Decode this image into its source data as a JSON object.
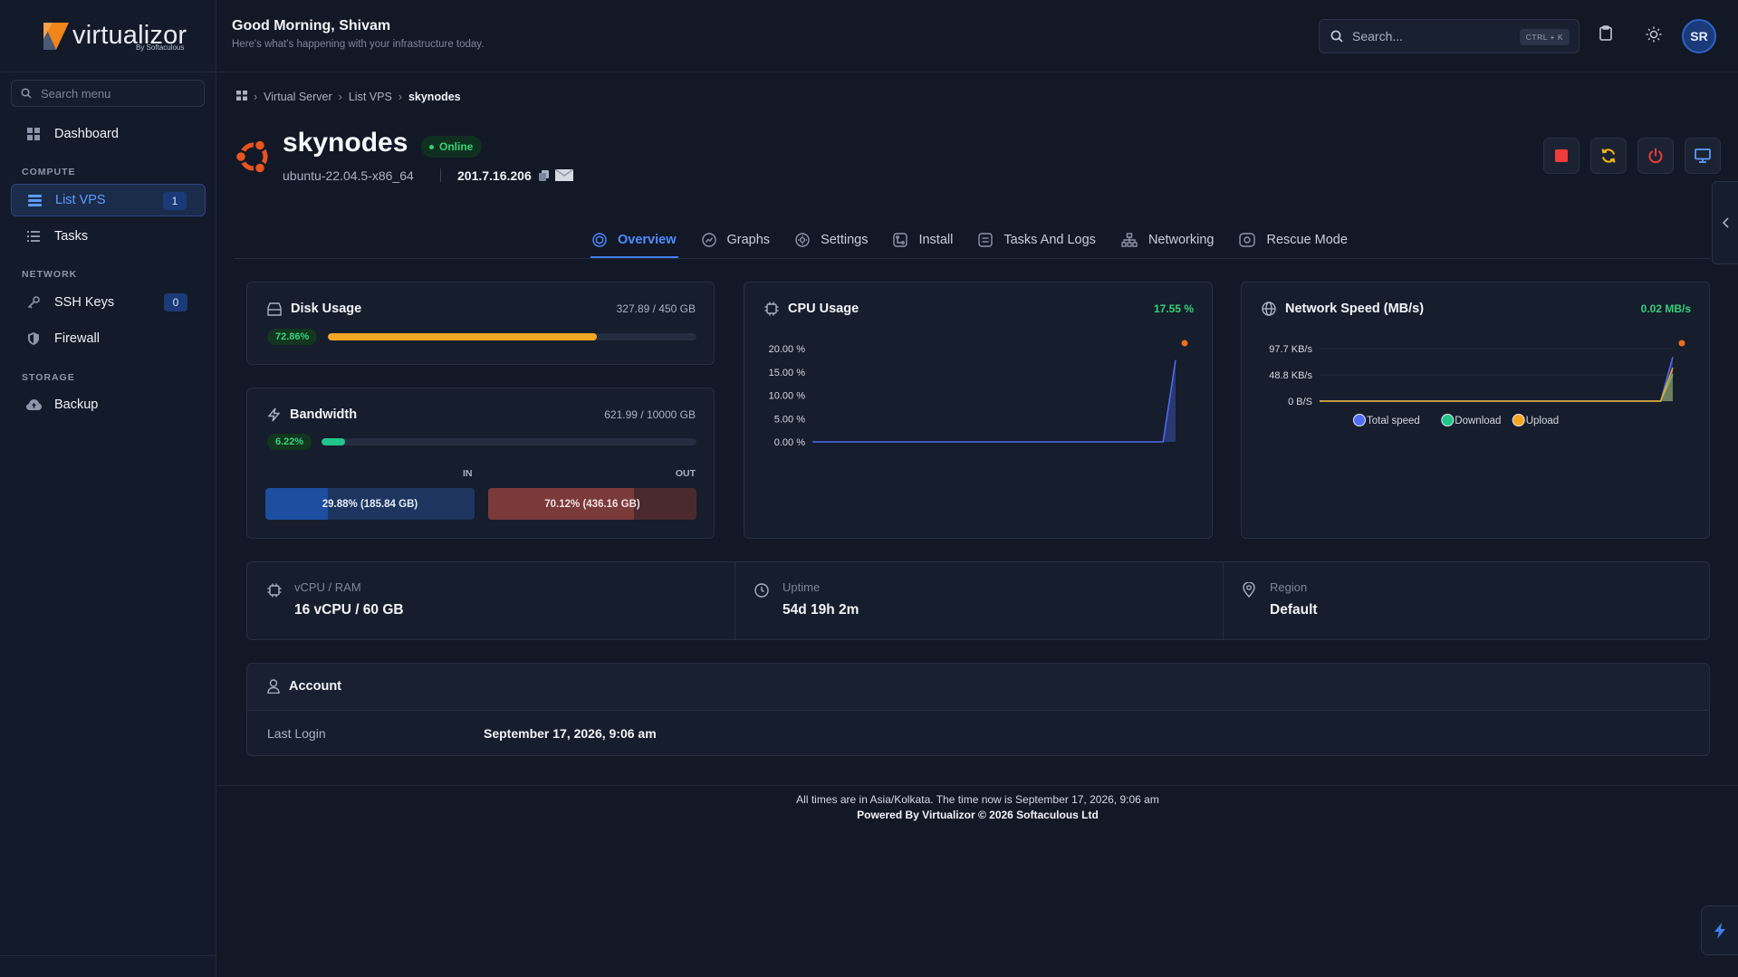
{
  "sidebar": {
    "logo_text": "virtualizor",
    "logo_sub": "By Softaculous",
    "search_placeholder": "Search menu",
    "dashboard": "Dashboard",
    "sections": {
      "compute": "COMPUTE",
      "network": "NETWORK",
      "storage": "STORAGE"
    },
    "list_vps": {
      "label": "List VPS",
      "count": "1"
    },
    "tasks": "Tasks",
    "ssh_keys": {
      "label": "SSH Keys",
      "count": "0"
    },
    "firewall": "Firewall",
    "backup": "Backup"
  },
  "header": {
    "greeting": "Good Morning, Shivam",
    "subtitle": "Here's what's happening with your infrastructure today.",
    "search_placeholder": "Search...",
    "shortcut": "CTRL + K",
    "avatar_initials": "SR"
  },
  "breadcrumb": {
    "items": [
      "Virtual Server",
      "List VPS"
    ],
    "current": "skynodes"
  },
  "vps": {
    "name": "skynodes",
    "status": "Online",
    "os": "ubuntu-22.04.5-x86_64",
    "ip": "201.7.16.206"
  },
  "tabs": [
    "Overview",
    "Graphs",
    "Settings",
    "Install",
    "Tasks And Logs",
    "Networking",
    "Rescue Mode"
  ],
  "disk": {
    "title": "Disk Usage",
    "usage": "327.89 / 450 GB",
    "percent_label": "72.86%",
    "percent": 72.86
  },
  "bandwidth": {
    "title": "Bandwidth",
    "usage": "621.99 / 10000 GB",
    "percent_label": "6.22%",
    "percent": 6.22,
    "in_label": "IN",
    "out_label": "OUT",
    "in_text": "29.88% (185.84 GB)",
    "out_text": "70.12% (436.16 GB)",
    "in_percent": 29.88,
    "out_percent": 70.12
  },
  "cpu": {
    "title": "CPU Usage",
    "value": "17.55 %"
  },
  "network": {
    "title": "Network Speed (MB/s)",
    "value": "0.02 MB/s"
  },
  "chart_data": [
    {
      "type": "area",
      "title": "CPU Usage",
      "y_ticks": [
        "20.00 %",
        "15.00 %",
        "10.00 %",
        "5.00 %",
        "0.00 %"
      ],
      "ylim": [
        0,
        20
      ],
      "series": [
        {
          "values": [
            0,
            0,
            0,
            0,
            0,
            0,
            0,
            0,
            0,
            0,
            0,
            0,
            0,
            0,
            0,
            0,
            0,
            0,
            0,
            0,
            0,
            0,
            0,
            0,
            0,
            0,
            0,
            0,
            0,
            17.55
          ]
        }
      ]
    },
    {
      "type": "area",
      "title": "Network Speed (MB/s)",
      "y_ticks": [
        "97.7 KB/s",
        "48.8 KB/s",
        "0 B/S"
      ],
      "ylim": [
        0,
        97.7
      ],
      "series": [
        {
          "name": "Total speed",
          "color": "#4f6df5",
          "values": [
            0,
            0,
            0,
            0,
            0,
            0,
            0,
            0,
            0,
            0,
            0,
            0,
            0,
            0,
            0,
            0,
            0,
            0,
            0,
            0,
            0,
            0,
            0,
            0,
            0,
            0,
            0,
            0,
            0,
            82
          ]
        },
        {
          "name": "Download",
          "color": "#22c58b",
          "values": [
            0,
            0,
            0,
            0,
            0,
            0,
            0,
            0,
            0,
            0,
            0,
            0,
            0,
            0,
            0,
            0,
            0,
            0,
            0,
            0,
            0,
            0,
            0,
            0,
            0,
            0,
            0,
            0,
            0,
            50
          ]
        },
        {
          "name": "Upload",
          "color": "#f5a623",
          "values": [
            0,
            0,
            0,
            0,
            0,
            0,
            0,
            0,
            0,
            0,
            0,
            0,
            0,
            0,
            0,
            0,
            0,
            0,
            0,
            0,
            0,
            0,
            0,
            0,
            0,
            0,
            0,
            0,
            0,
            62
          ]
        }
      ]
    }
  ],
  "stats": {
    "vcpu_label": "vCPU / RAM",
    "vcpu_value": "16 vCPU / 60 GB",
    "uptime_label": "Uptime",
    "uptime_value": "54d 19h 2m",
    "region_label": "Region",
    "region_value": "Default"
  },
  "account": {
    "title": "Account",
    "last_login_label": "Last Login",
    "last_login_value": "September 17, 2026, 9:06 am"
  },
  "footer": {
    "line1": "All times are in Asia/Kolkata. The time now is September 17, 2026, 9:06 am",
    "line2": "Powered By Virtualizor © 2026 Softaculous Ltd"
  },
  "colors": {
    "accent": "#3f7ef5",
    "success": "#35d27a",
    "disk_bar": "#f5a623",
    "bandwidth_bar": "#22c58b",
    "in_bar": "#1d4ea0",
    "out_bar": "#7a3a3a"
  },
  "icons": [
    "search-icon",
    "clipboard-icon",
    "sun-icon",
    "ubuntu-logo-icon",
    "copy-icon",
    "email-icon",
    "stop-icon",
    "restart-icon",
    "power-icon",
    "console-icon",
    "bolt-icon"
  ]
}
